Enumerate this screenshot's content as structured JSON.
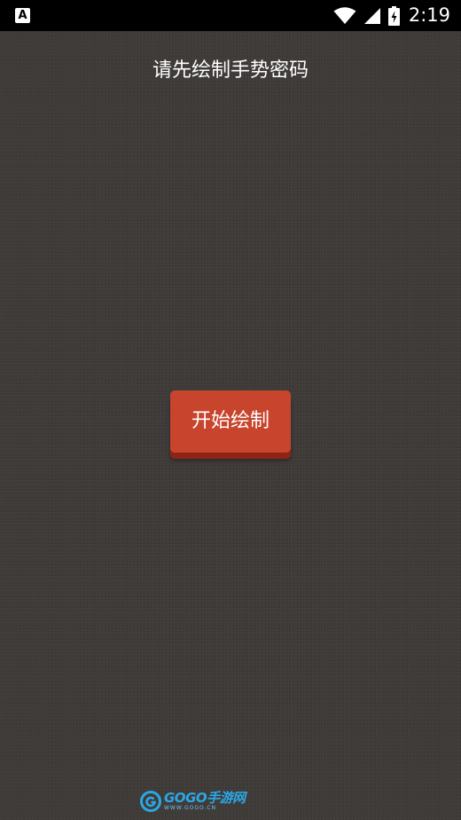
{
  "status_bar": {
    "notification_letter": "A",
    "time": "2:19",
    "icons": [
      "notification-a-icon",
      "wifi-icon",
      "cell-signal-icon",
      "battery-charging-icon"
    ]
  },
  "main": {
    "prompt": "请先绘制手势密码",
    "start_button_label": "开始绘制"
  },
  "watermark": {
    "brand": "GOGO手游网",
    "url": "WWW.GOGO.CN"
  },
  "colors": {
    "background": "#3e3a38",
    "status_bar": "#000000",
    "button": "#c8442c",
    "button_shadow": "#8e2415",
    "text": "#ffffff",
    "watermark": "#2aa8e6"
  }
}
